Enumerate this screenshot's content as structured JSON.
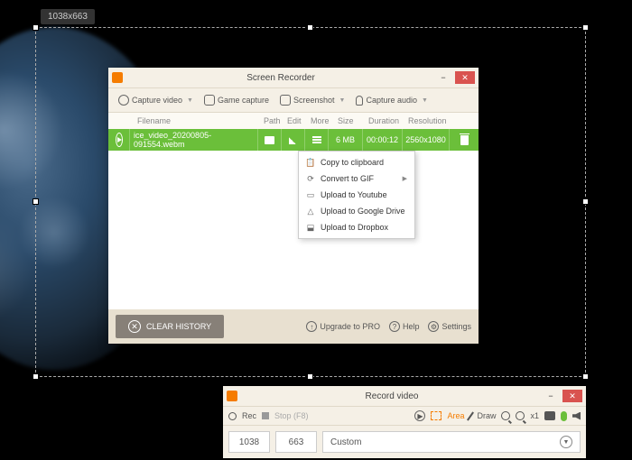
{
  "badge": "1038x663",
  "main": {
    "title": "Screen Recorder",
    "toolbar": {
      "capture_video": "Capture video",
      "game_capture": "Game capture",
      "screenshot": "Screenshot",
      "capture_audio": "Capture audio"
    },
    "headers": {
      "filename": "Filename",
      "path": "Path",
      "edit": "Edit",
      "more": "More",
      "size": "Size",
      "duration": "Duration",
      "resolution": "Resolution"
    },
    "row": {
      "filename": "ice_video_20200805-091554.webm",
      "size": "6 MB",
      "duration": "00:00:12",
      "resolution": "2560x1080"
    },
    "context_menu": {
      "copy_clipboard": "Copy to clipboard",
      "convert_gif": "Convert to GIF",
      "upload_youtube": "Upload to Youtube",
      "upload_gdrive": "Upload to Google Drive",
      "upload_dropbox": "Upload to Dropbox"
    },
    "footer": {
      "clear_history": "CLEAR HISTORY",
      "upgrade": "Upgrade to PRO",
      "help": "Help",
      "settings": "Settings"
    }
  },
  "record": {
    "title": "Record video",
    "rec": "Rec",
    "stop": "Stop (F8)",
    "area": "Area",
    "draw": "Draw",
    "zoom": "x1",
    "width": "1038",
    "height": "663",
    "mode": "Custom"
  }
}
